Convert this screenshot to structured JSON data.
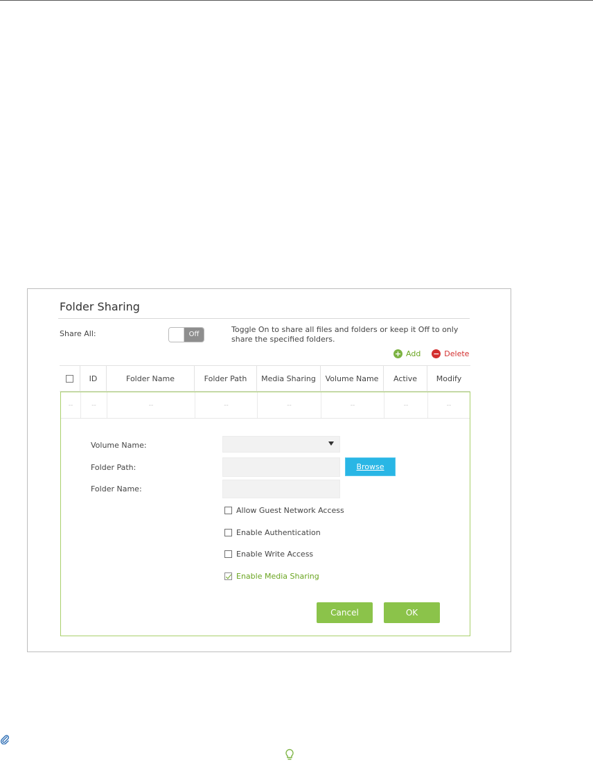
{
  "panel": {
    "title": "Folder Sharing",
    "share_all_label": "Share All:",
    "toggle_state": "Off",
    "share_all_description": "Toggle On to share all files and folders or keep it Off to only share the specified folders.",
    "add_label": "Add",
    "delete_label": "Delete"
  },
  "table": {
    "headers": [
      "ID",
      "Folder Name",
      "Folder Path",
      "Media Sharing",
      "Volume Name",
      "Active",
      "Modify"
    ],
    "row": [
      "--",
      "--",
      "--",
      "--",
      "--",
      "--",
      "--",
      "--"
    ]
  },
  "form": {
    "volume_name_label": "Volume Name:",
    "volume_name_value": "",
    "folder_path_label": "Folder Path:",
    "folder_path_value": "",
    "browse_label": "Browse",
    "folder_name_label": "Folder Name:",
    "folder_name_value": "",
    "checkboxes": [
      {
        "label": "Allow Guest Network Access",
        "checked": false
      },
      {
        "label": "Enable Authentication",
        "checked": false
      },
      {
        "label": "Enable Write Access",
        "checked": false
      },
      {
        "label": "Enable Media Sharing",
        "checked": true
      }
    ],
    "cancel_label": "Cancel",
    "ok_label": "OK"
  },
  "colors": {
    "accent_green": "#8bc34a",
    "browse_blue": "#29b6e5",
    "delete_red": "#d32f2f"
  },
  "icons": {
    "page_left": "paperclip-icon",
    "page_bottom": "lightbulb-icon"
  }
}
